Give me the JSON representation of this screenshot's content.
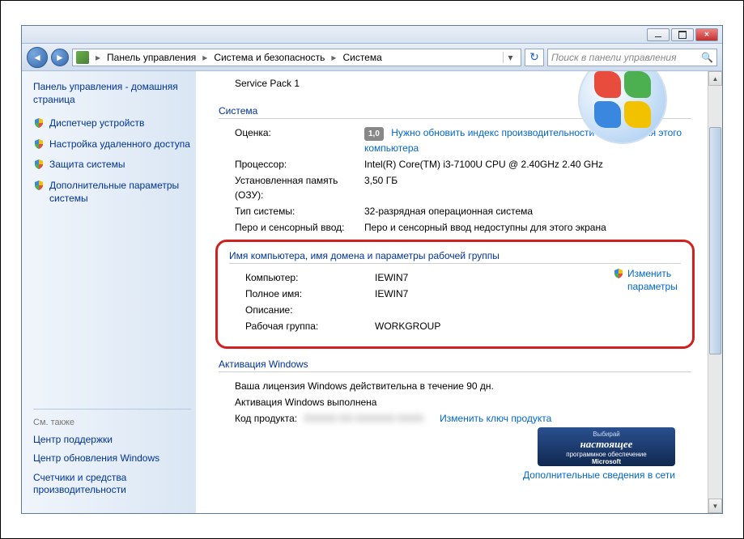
{
  "breadcrumb": {
    "root": "Панель управления",
    "level1": "Система и безопасность",
    "level2": "Система"
  },
  "search": {
    "placeholder": "Поиск в панели управления"
  },
  "sidebar": {
    "home": "Панель управления - домашняя страница",
    "links": [
      "Диспетчер устройств",
      "Настройка удаленного доступа",
      "Защита системы",
      "Дополнительные параметры системы"
    ],
    "see_also_hdr": "См. также",
    "see_also": [
      "Центр поддержки",
      "Центр обновления Windows",
      "Счетчики и средства производительности"
    ]
  },
  "main": {
    "service_pack": "Service Pack 1",
    "system_hdr": "Система",
    "rating_lbl": "Оценка:",
    "rating_val": "1,0",
    "rating_link": "Нужно обновить индекс производительности Windows для этого компьютера",
    "cpu_lbl": "Процессор:",
    "cpu_val": "Intel(R) Core(TM) i3-7100U CPU @ 2.40GHz   2.40 GHz",
    "ram_lbl": "Установленная память (ОЗУ):",
    "ram_val": "3,50 ГБ",
    "type_lbl": "Тип системы:",
    "type_val": "32-разрядная операционная система",
    "pen_lbl": "Перо и сенсорный ввод:",
    "pen_val": "Перо и сенсорный ввод недоступны для этого экрана",
    "name_hdr": "Имя компьютера, имя домена и параметры рабочей группы",
    "computer_lbl": "Компьютер:",
    "computer_val": "IEWIN7",
    "fullname_lbl": "Полное имя:",
    "fullname_val": "IEWIN7",
    "desc_lbl": "Описание:",
    "desc_val": "",
    "workgroup_lbl": "Рабочая группа:",
    "workgroup_val": "WORKGROUP",
    "change_settings": "Изменить параметры",
    "activation_hdr": "Активация Windows",
    "license_text": "Ваша лицензия Windows действительна в течение 90 дн.",
    "activation_done": "Активация Windows выполнена",
    "product_key_lbl": "Код продукта:",
    "change_key": "Изменить ключ продукта",
    "banner_top": "Выбирай",
    "banner_mid": "настоящее",
    "banner_bot": "программное обеспечение",
    "banner_ms": "Microsoft",
    "more_online": "Дополнительные сведения в сети"
  }
}
